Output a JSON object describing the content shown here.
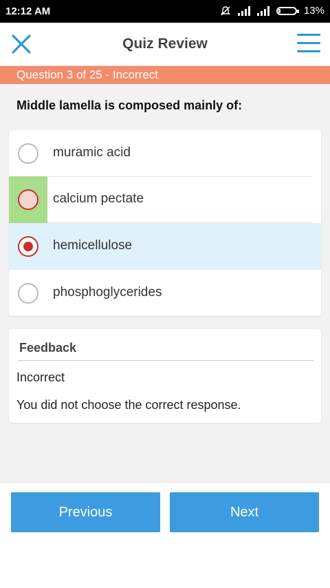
{
  "status_bar": {
    "time": "12:12 AM",
    "battery_percent": "13%",
    "icons": [
      "notifications-off-icon",
      "signal-icon",
      "signal-icon",
      "battery-icon"
    ]
  },
  "header": {
    "title": "Quiz Review",
    "close_icon": "close-icon",
    "menu_icon": "hamburger-menu-icon",
    "accent_color": "#2a96d6"
  },
  "question_banner": {
    "text": "Question 3 of 25 - Incorrect",
    "color": "#f28c6b"
  },
  "question": {
    "text": "Middle lamella is composed mainly of:"
  },
  "options": [
    {
      "label": "muramic acid",
      "state": "none"
    },
    {
      "label": "calcium pectate",
      "state": "correct"
    },
    {
      "label": "hemicellulose",
      "state": "selected"
    },
    {
      "label": "phosphoglycerides",
      "state": "none"
    }
  ],
  "feedback": {
    "heading": "Feedback",
    "result": "Incorrect",
    "message": "You did not choose the correct response."
  },
  "navigation": {
    "previous_label": "Previous",
    "next_label": "Next",
    "button_color": "#3d9be0"
  }
}
